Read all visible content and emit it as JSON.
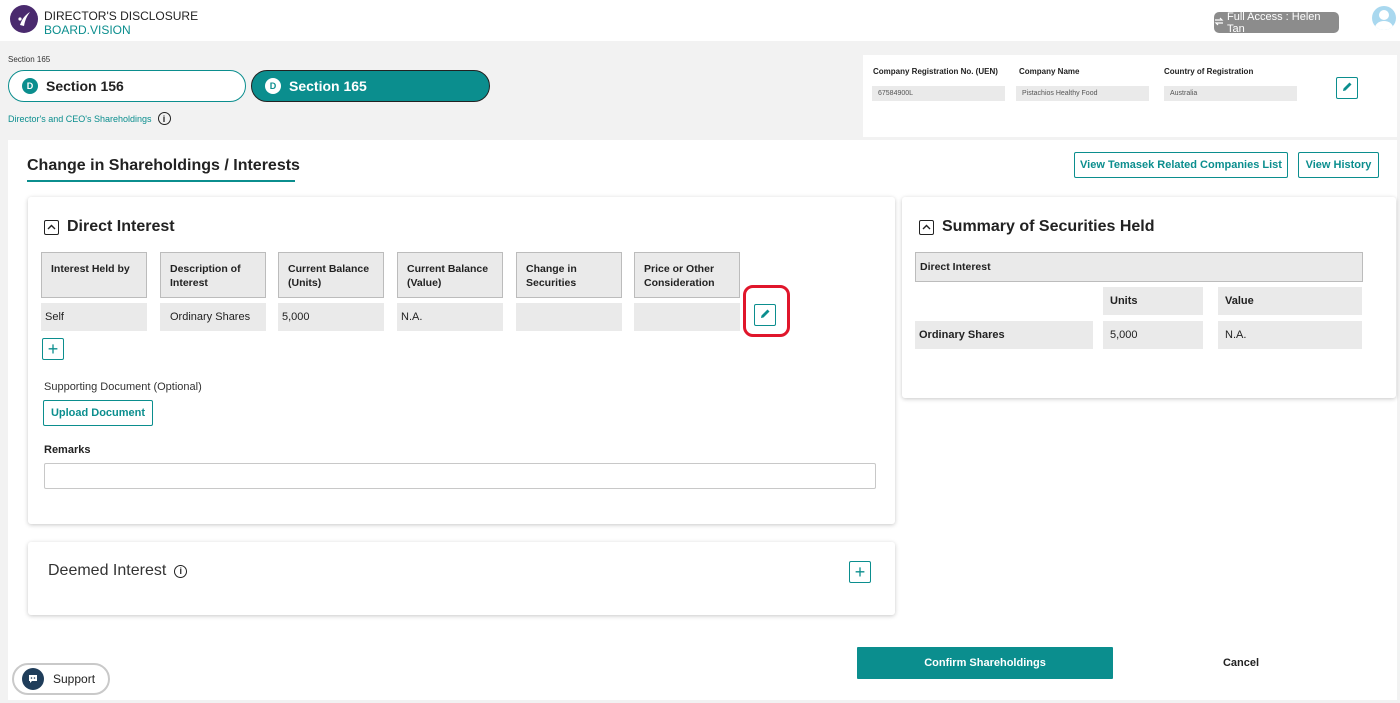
{
  "header": {
    "app_title": "DIRECTOR'S DISCLOSURE",
    "app_subtitle": "BOARD.VISION",
    "access_label": "Full Access : Helen Tan"
  },
  "breadcrumb": "Section 165",
  "sections": [
    {
      "label": "Section 156",
      "active": false
    },
    {
      "label": "Section 165",
      "active": true
    }
  ],
  "shareholdings_link": "Director's and CEO's Shareholdings",
  "company": {
    "uen_label": "Company Registration No. (UEN)",
    "uen_value": "67584900L",
    "name_label": "Company Name",
    "name_value": "Pistachios Healthy Food",
    "country_label": "Country of Registration",
    "country_value": "Australia"
  },
  "main": {
    "title": "Change in Shareholdings / Interests",
    "view_temasek_label": "View Temasek Related Companies List",
    "view_history_label": "View History"
  },
  "direct_interest": {
    "title": "Direct Interest",
    "columns": [
      "Interest Held by",
      "Description of Interest",
      "Current Balance (Units)",
      "Current Balance (Value)",
      "Change in Securities",
      "Price or Other Consideration"
    ],
    "row": [
      "Self",
      "Ordinary Shares",
      "5,000",
      "N.A.",
      "",
      ""
    ],
    "supporting_label": "Supporting Document (Optional)",
    "upload_label": "Upload Document",
    "remarks_label": "Remarks",
    "remarks_value": ""
  },
  "deemed_interest": {
    "title": "Deemed Interest"
  },
  "summary": {
    "title": "Summary of Securities Held",
    "section_label": "Direct Interest",
    "units_header": "Units",
    "value_header": "Value",
    "row_label": "Ordinary Shares",
    "row_units": "5,000",
    "row_value": "N.A."
  },
  "footer": {
    "confirm_label": "Confirm Shareholdings",
    "cancel_label": "Cancel",
    "support_label": "Support"
  },
  "colors": {
    "accent": "#0b8e8e",
    "highlight": "#e0162b",
    "logo": "#4a2a6e"
  }
}
